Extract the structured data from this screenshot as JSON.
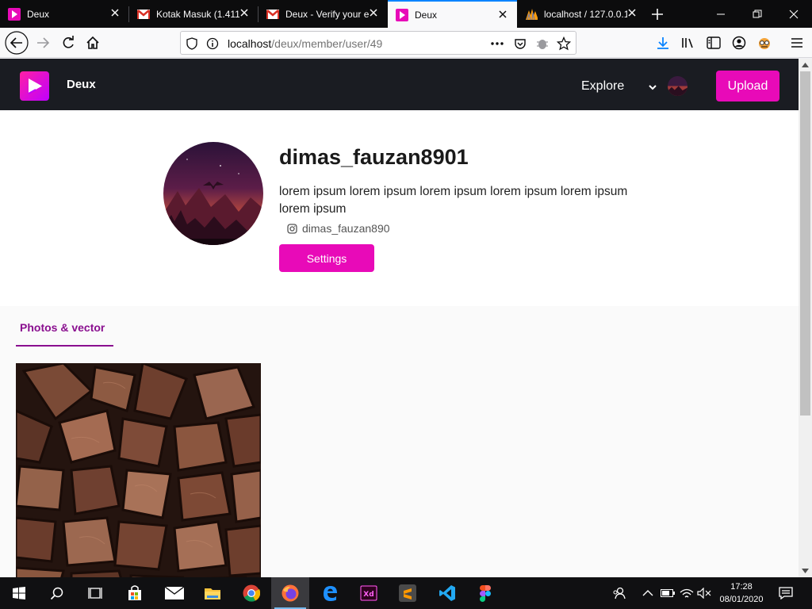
{
  "browser": {
    "tabs": [
      {
        "title": "Deux",
        "favicon": "deux-logo-icon"
      },
      {
        "title": "Kotak Masuk (1.411",
        "favicon": "gmail-icon"
      },
      {
        "title": "Deux - Verify your e",
        "favicon": "gmail-icon"
      },
      {
        "title": "Deux",
        "favicon": "deux-logo-icon"
      },
      {
        "title": "localhost / 127.0.0.1",
        "favicon": "phpmyadmin-icon"
      }
    ],
    "active_tab": 3,
    "url_host": "localhost",
    "url_path": "/deux/member/user/49"
  },
  "site": {
    "brand": "Deux",
    "nav_explore": "Explore",
    "upload_label": "Upload",
    "accent_color": "#e80ab8",
    "header_color": "#1a1c22"
  },
  "profile": {
    "username": "dimas_fauzan8901",
    "bio": "lorem ipsum lorem ipsum lorem ipsum lorem ipsum lorem ipsum lorem ipsum",
    "instagram": "dimas_fauzan890",
    "settings_label": "Settings"
  },
  "gallery": {
    "tab_label": "Photos & vector",
    "tab_color": "#8a0f8f"
  },
  "taskbar": {
    "time": "17:28",
    "date": "08/01/2020",
    "apps": [
      "start-icon",
      "search-icon",
      "task-view-icon",
      "store-icon",
      "mail-icon",
      "file-explorer-icon",
      "chrome-icon",
      "firefox-icon",
      "edge-icon",
      "adobe-xd-icon",
      "sublime-text-icon",
      "vscode-icon",
      "figma-icon"
    ]
  }
}
